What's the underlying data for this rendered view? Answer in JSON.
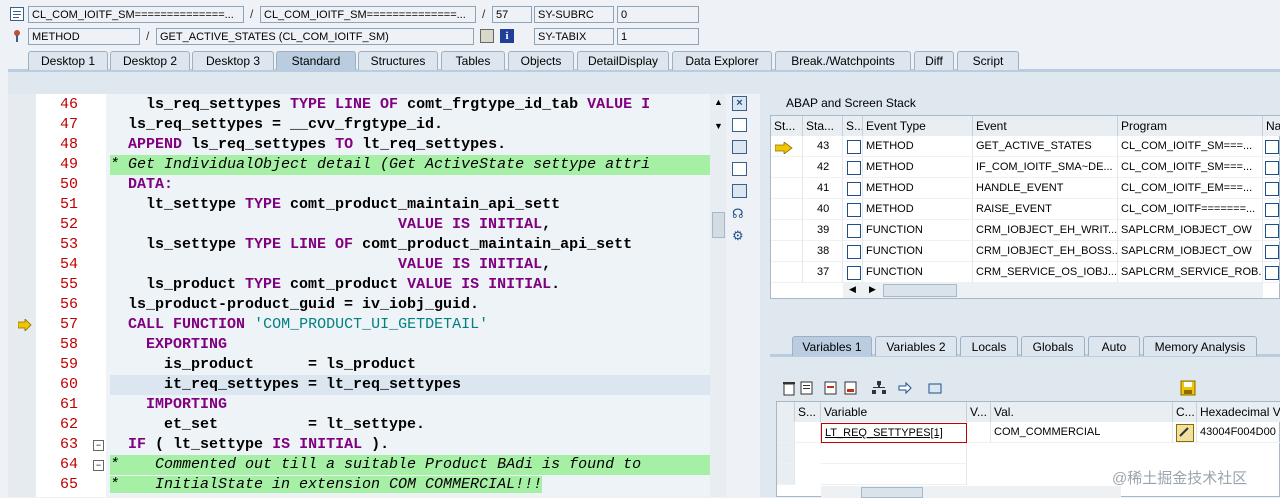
{
  "header": {
    "row1": {
      "program": "CL_COM_IOITF_SM==============...",
      "include": "CL_COM_IOITF_SM==============...",
      "line": "57",
      "var_name": "SY-SUBRC",
      "var_value": "0"
    },
    "row2": {
      "type": "METHOD",
      "event": "GET_ACTIVE_STATES (CL_COM_IOITF_SM)",
      "var_name": "SY-TABIX",
      "var_value": "1"
    }
  },
  "tabs": [
    "Desktop 1",
    "Desktop 2",
    "Desktop 3",
    "Standard",
    "Structures",
    "Tables",
    "Objects",
    "DetailDisplay",
    "Data Explorer",
    "Break./Watchpoints",
    "Diff",
    "Script"
  ],
  "code": {
    "line_numbers": [
      "46",
      "47",
      "48",
      "49",
      "50",
      "51",
      "52",
      "53",
      "54",
      "55",
      "56",
      "57",
      "58",
      "59",
      "60",
      "61",
      "62",
      "63",
      "64",
      "65"
    ]
  },
  "stack": {
    "title": "ABAP and Screen Stack",
    "columns": [
      "St...",
      "Sta...",
      "S...",
      "Event Type",
      "Event",
      "Program",
      "Na"
    ],
    "rows": [
      {
        "level": "43",
        "type": "METHOD",
        "event": "GET_ACTIVE_STATES",
        "program": "CL_COM_IOITF_SM===..."
      },
      {
        "level": "42",
        "type": "METHOD",
        "event": "IF_COM_IOITF_SMA~DE...",
        "program": "CL_COM_IOITF_SM===..."
      },
      {
        "level": "41",
        "type": "METHOD",
        "event": "HANDLE_EVENT",
        "program": "CL_COM_IOITF_EM===..."
      },
      {
        "level": "40",
        "type": "METHOD",
        "event": "RAISE_EVENT",
        "program": "CL_COM_IOITF=======..."
      },
      {
        "level": "39",
        "type": "FUNCTION",
        "event": "CRM_IOBJECT_EH_WRIT...",
        "program": "SAPLCRM_IOBJECT_OW"
      },
      {
        "level": "38",
        "type": "FUNCTION",
        "event": "CRM_IOBJECT_EH_BOSS...",
        "program": "SAPLCRM_IOBJECT_OW"
      },
      {
        "level": "37",
        "type": "FUNCTION",
        "event": "CRM_SERVICE_OS_IOBJ...",
        "program": "SAPLCRM_SERVICE_ROB..."
      }
    ]
  },
  "var_tabs": [
    "Variables 1",
    "Variables 2",
    "Locals",
    "Globals",
    "Auto",
    "Memory Analysis"
  ],
  "variables": {
    "columns": [
      "S...",
      "Variable",
      "V...",
      "Val.",
      "C...",
      "Hexadecimal V"
    ],
    "rows": [
      {
        "variable": "LT_REQ_SETTYPES[1]",
        "value": "COM_COMMERCIAL",
        "hex": "43004F004D00"
      }
    ]
  },
  "watermark": "@稀土掘金技术社区"
}
